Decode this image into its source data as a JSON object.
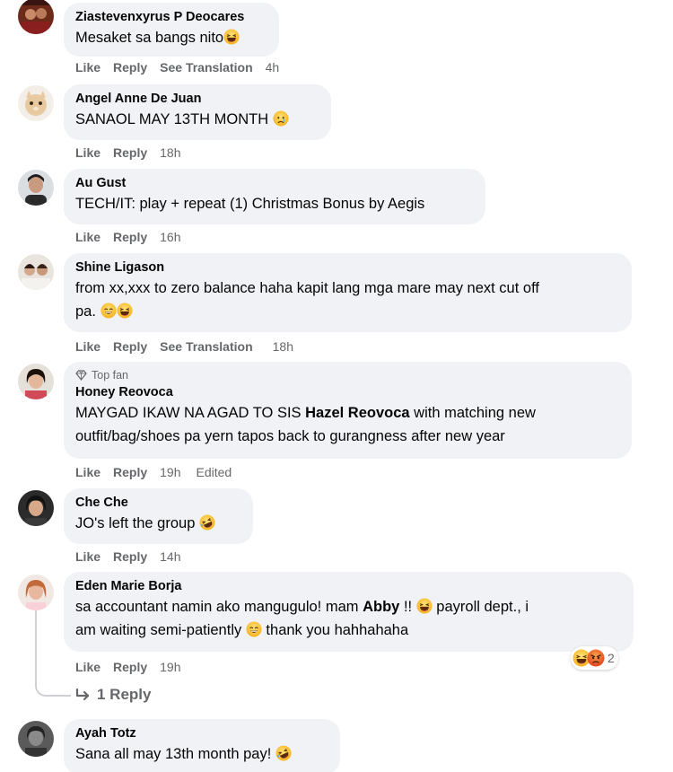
{
  "comments": [
    {
      "name": "Ziastevenxyrus P Deocares",
      "text": "Mesaket sa bangs nito",
      "actions": {
        "like": "Like",
        "reply": "Reply",
        "translate": "See Translation",
        "time": "4h"
      }
    },
    {
      "name": "Angel Anne De Juan",
      "text": "SANAOL MAY 13TH MONTH",
      "actions": {
        "like": "Like",
        "reply": "Reply",
        "time": "18h"
      }
    },
    {
      "name": "Au Gust",
      "text": "TECH/IT: play + repeat (1) Christmas Bonus by Aegis",
      "actions": {
        "like": "Like",
        "reply": "Reply",
        "time": "16h"
      }
    },
    {
      "name": "Shine Ligason",
      "text_line1": "from xx,xxx to zero balance haha kapit lang mga mare may next cut off",
      "text_line2": "pa.",
      "actions": {
        "like": "Like",
        "reply": "Reply",
        "translate": "See Translation",
        "time": "18h"
      }
    },
    {
      "badge": "Top fan",
      "name": "Honey Reovoca",
      "text_part1": "MAYGAD IKAW NA AGAD TO SIS ",
      "mention": "Hazel Reovoca",
      "text_part2": " with matching new",
      "text_line2": "outfit/bag/shoes pa yern tapos back to gurangness after new year",
      "actions": {
        "like": "Like",
        "reply": "Reply",
        "time": "19h",
        "edited": "Edited"
      }
    },
    {
      "name": "Che Che",
      "text": "JO's left the group",
      "actions": {
        "like": "Like",
        "reply": "Reply",
        "time": "14h"
      }
    },
    {
      "name": "Eden Marie Borja",
      "text_part1": "sa accountant namin ako mangugulo! mam ",
      "mention": "Abby",
      "text_part2": " !!",
      "text_part3": " payroll dept., i",
      "text_line2a": "am waiting semi-patiently",
      "text_line2b": " thank you hahhahaha",
      "actions": {
        "like": "Like",
        "reply": "Reply",
        "time": "19h"
      },
      "reaction_count": "2",
      "view_replies": "1 Reply"
    },
    {
      "name": "Ayah Totz",
      "text": "Sana all may 13th month pay!"
    }
  ],
  "colors": {
    "bubble": "#f0f2f5",
    "meta": "#65676b",
    "text": "#050505"
  },
  "icons": {
    "laugh": "grinning-squint-emoji",
    "sad": "crying-face-emoji",
    "rofl": "rolling-laughing-emoji",
    "smile": "smiling-emoji",
    "angry": "angry-emoji",
    "diamond": "top-fan-diamond-icon",
    "reply_arrow": "reply-arrow-icon"
  }
}
